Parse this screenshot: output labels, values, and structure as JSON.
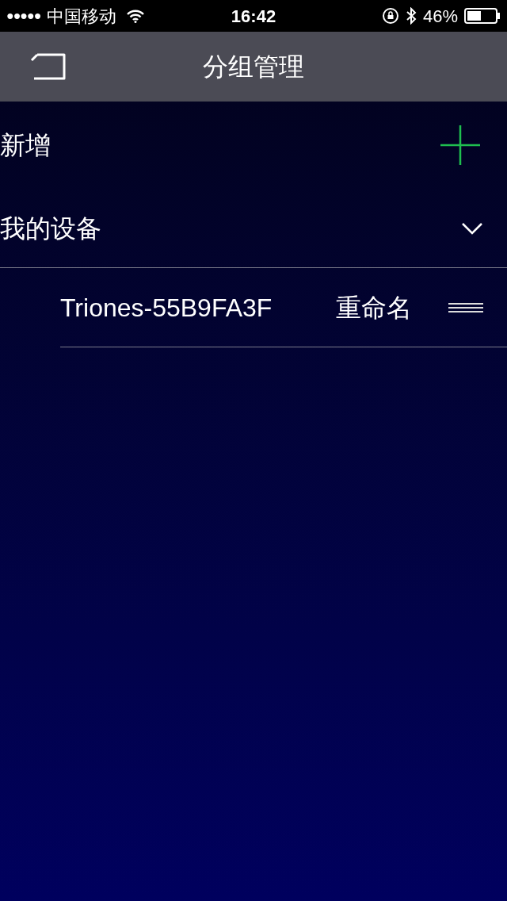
{
  "status_bar": {
    "signal": "●●●●●",
    "carrier": "中国移动",
    "time": "16:42",
    "battery": "46%"
  },
  "nav": {
    "title": "分组管理"
  },
  "add_row": {
    "label": "新增"
  },
  "group": {
    "label": "我的设备",
    "expanded": true,
    "devices": [
      {
        "name": "Triones-55B9FA3F",
        "action": "重命名"
      }
    ]
  }
}
